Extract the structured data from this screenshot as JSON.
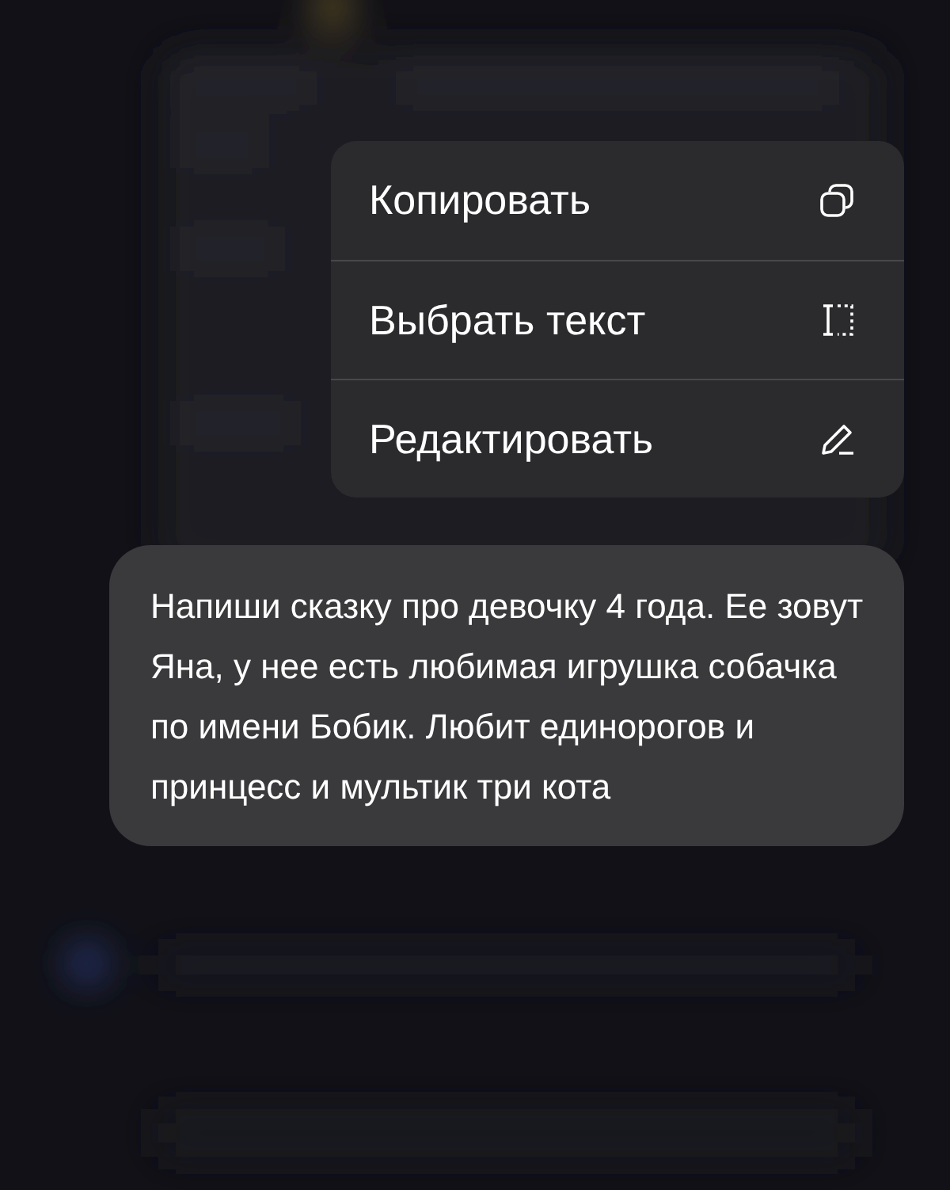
{
  "context_menu": {
    "items": [
      {
        "label": "Копировать",
        "kind": "copy"
      },
      {
        "label": "Выбрать текст",
        "kind": "select"
      },
      {
        "label": "Редактировать",
        "kind": "edit"
      }
    ]
  },
  "message": {
    "text": "Напиши сказку про девочку 4 года. Ее зовут Яна, у нее есть любимая игрушка собачка по имени Бобик. Любит единорогов и принцесс и мультик три кота"
  }
}
